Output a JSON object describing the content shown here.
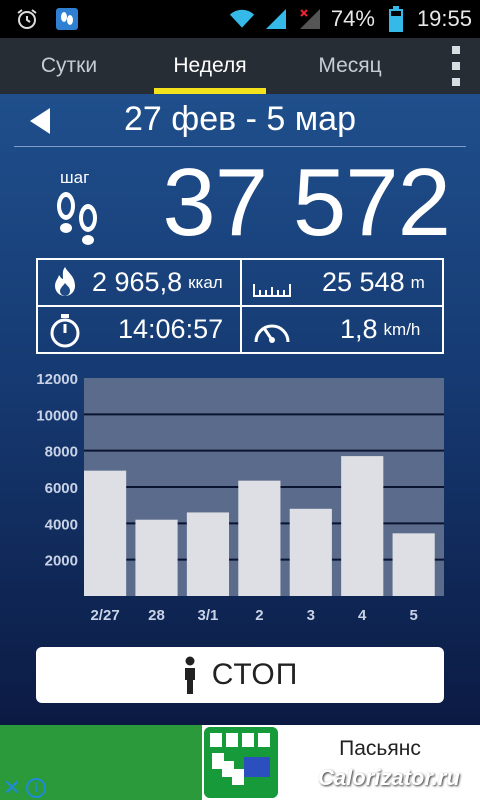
{
  "status_bar": {
    "battery": "74%",
    "time": "19:55",
    "icons": [
      "alarm-clock-icon",
      "pedometer-icon",
      "wifi-icon",
      "signal-icon",
      "no-signal-icon",
      "battery-icon"
    ]
  },
  "tabs": [
    {
      "label": "Сутки",
      "active": false
    },
    {
      "label": "Неделя",
      "active": true
    },
    {
      "label": "Месяц",
      "active": false
    }
  ],
  "period": {
    "label": "27 фев - 5 мар"
  },
  "steps": {
    "unit": "шаг",
    "value": "37 572"
  },
  "stats": {
    "calories": {
      "value": "2 965,8",
      "unit": "ккал"
    },
    "distance": {
      "value": "25 548",
      "unit": "m"
    },
    "duration": {
      "value": "14:06:57"
    },
    "speed": {
      "value": "1,8",
      "unit": "km/h"
    }
  },
  "chart_data": {
    "type": "bar",
    "categories": [
      "2/27",
      "28",
      "3/1",
      "2",
      "3",
      "4",
      "5"
    ],
    "values": [
      6900,
      4200,
      4600,
      6350,
      4800,
      7700,
      3450
    ],
    "ylim": [
      0,
      12000
    ],
    "yticks": [
      "12000",
      "10000",
      "8000",
      "6000",
      "4000",
      "2000"
    ],
    "grid": true,
    "colors": {
      "bar": "#dedfe4",
      "plot_bg": "#5a6b8c",
      "grid": "#0a1430",
      "tick_label": "#c9d2e6"
    }
  },
  "stop_button": {
    "label": "СТОП"
  },
  "ad": {
    "title": "Пасьянс",
    "watermark": "Calorizator.ru"
  },
  "colors": {
    "accent": "#f4e31c",
    "tabbar": "#262d34"
  }
}
